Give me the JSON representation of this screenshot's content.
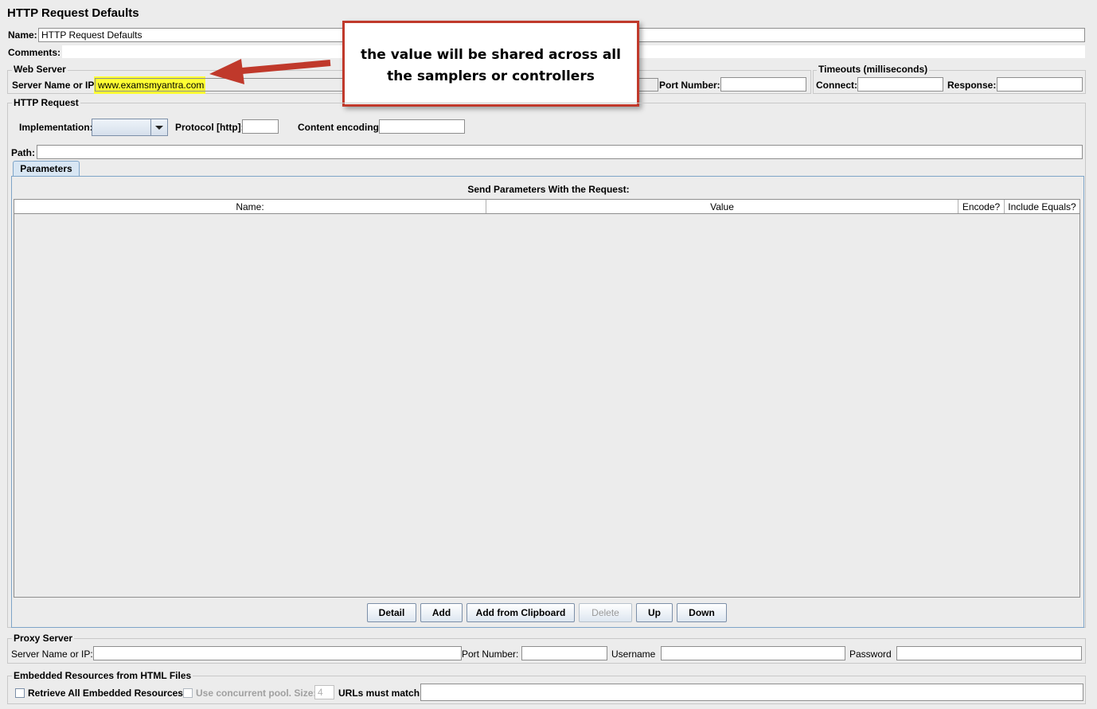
{
  "page_title": "HTTP Request Defaults",
  "name_label": "Name:",
  "name_value": "HTTP Request Defaults",
  "comments_label": "Comments:",
  "web_server": {
    "legend": "Web Server",
    "server_label": "Server Name or IP:",
    "server_value": "www.examsmyantra.com",
    "port_label": "Port Number:"
  },
  "timeouts": {
    "legend": "Timeouts (milliseconds)",
    "connect_label": "Connect:",
    "response_label": "Response:"
  },
  "http_request": {
    "legend": "HTTP Request",
    "implementation_label": "Implementation:",
    "protocol_label": "Protocol [http]:",
    "encoding_label": "Content encoding:",
    "path_label": "Path:"
  },
  "parameters": {
    "tab_label": "Parameters",
    "heading": "Send Parameters With the Request:",
    "columns": [
      "Name:",
      "Value",
      "Encode?",
      "Include Equals?"
    ],
    "buttons": [
      "Detail",
      "Add",
      "Add from Clipboard",
      "Delete",
      "Up",
      "Down"
    ]
  },
  "proxy": {
    "legend": "Proxy Server",
    "server_label": "Server Name or IP:",
    "port_label": "Port Number:",
    "username_label": "Username",
    "password_label": "Password"
  },
  "embedded": {
    "legend": "Embedded Resources from HTML Files",
    "retrieve_label": "Retrieve All Embedded Resources",
    "concurrent_label": "Use concurrent pool. Size:",
    "pool_size": "4",
    "urls_label": "URLs must match:"
  },
  "annotation": {
    "line1": "the value will be shared across all",
    "line2": "the samplers or controllers",
    "arrow_color": "#c0392b"
  },
  "colors": {
    "highlight": "#ffff33",
    "tab_bg": "#d8e6f3",
    "panel_border": "#7ea4c8"
  }
}
